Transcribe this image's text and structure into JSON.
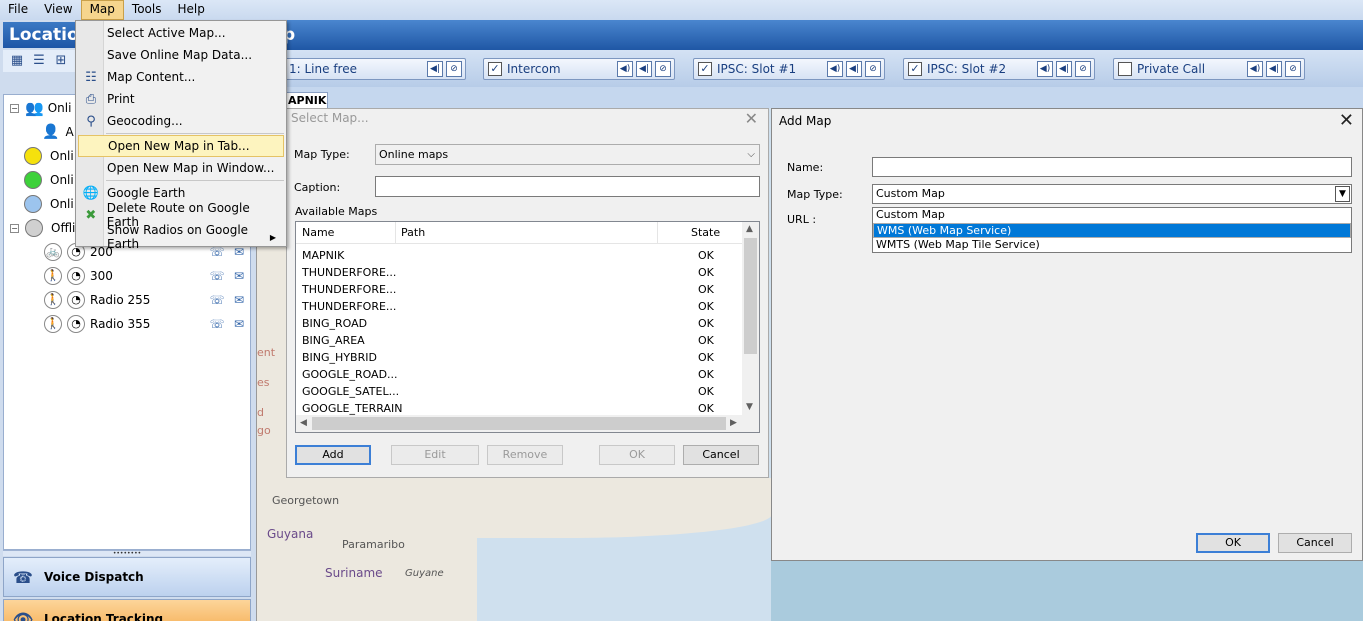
{
  "menubar": {
    "items": [
      "File",
      "View",
      "Map",
      "Tools",
      "Help"
    ]
  },
  "left": {
    "title": "Location",
    "tree": {
      "online_label": "Onli",
      "online_sub": "A",
      "statuses": [
        "Onli",
        "Onli",
        "Onli"
      ],
      "offline_label": "Offli",
      "radios": [
        {
          "name": "200",
          "mode": "bike"
        },
        {
          "name": "300",
          "mode": "walk"
        },
        {
          "name": "Radio 255",
          "mode": "walk"
        },
        {
          "name": "Radio 355",
          "mode": "walk"
        }
      ]
    },
    "nav": {
      "voice": "Voice Dispatch",
      "location": "Location Tracking"
    },
    "colors": {
      "yellow": "#f5e10d",
      "green": "#3ed13a",
      "blue": "#9cc4ee",
      "grey": "#d0d0d0"
    }
  },
  "topbar": {
    "title": "p"
  },
  "channels": [
    {
      "label": "1: Line free",
      "checked": false,
      "hasCheck": false
    },
    {
      "label": "Intercom",
      "checked": true,
      "hasCheck": true
    },
    {
      "label": "IPSC: Slot #1",
      "checked": true,
      "hasCheck": true
    },
    {
      "label": "IPSC: Slot #2",
      "checked": true,
      "hasCheck": true
    },
    {
      "label": "Private Call",
      "checked": false,
      "hasCheck": true
    }
  ],
  "map": {
    "tab": "APNIK",
    "labels": {
      "georgetown": "Georgetown",
      "guyana": "Guyana",
      "paramaribo": "Paramaribo",
      "suriname": "Suriname",
      "guyane": "Guyane",
      "ent": "ent",
      "es": "es",
      "d": "d",
      "go": "go"
    }
  },
  "map_menu": {
    "items": [
      "Select Active Map...",
      "Save Online Map Data...",
      "Map Content...",
      "Print",
      "Geocoding...",
      "Open New Map in Tab...",
      "Open New Map in Window...",
      "Google Earth",
      "Delete Route on Google Earth",
      "Show Radios on Google Earth"
    ]
  },
  "select_map": {
    "title": "Select Map...",
    "map_type_label": "Map Type:",
    "map_type_value": "Online maps",
    "caption_label": "Caption:",
    "available_label": "Available Maps",
    "columns": [
      "Name",
      "Path",
      "State"
    ],
    "rows": [
      {
        "name": "MAPNIK",
        "state": "OK"
      },
      {
        "name": "THUNDERFORE...",
        "state": "OK"
      },
      {
        "name": "THUNDERFORE...",
        "state": "OK"
      },
      {
        "name": "THUNDERFORE...",
        "state": "OK"
      },
      {
        "name": "BING_ROAD",
        "state": "OK"
      },
      {
        "name": "BING_AREA",
        "state": "OK"
      },
      {
        "name": "BING_HYBRID",
        "state": "OK"
      },
      {
        "name": "GOOGLE_ROAD...",
        "state": "OK"
      },
      {
        "name": "GOOGLE_SATEL...",
        "state": "OK"
      },
      {
        "name": "GOOGLE_TERRAIN",
        "state": "OK"
      }
    ],
    "buttons": {
      "add": "Add",
      "edit": "Edit",
      "remove": "Remove",
      "ok": "OK",
      "cancel": "Cancel"
    }
  },
  "add_map": {
    "title": "Add Map",
    "name_label": "Name:",
    "name_value": "",
    "map_type_label": "Map Type:",
    "map_type_value": "Custom Map",
    "url_label": "URL :",
    "options": [
      "Custom Map",
      "WMS (Web Map Service)",
      "WMTS (Web Map Tile Service)"
    ],
    "selected_index": 1,
    "buttons": {
      "ok": "OK",
      "cancel": "Cancel"
    }
  }
}
